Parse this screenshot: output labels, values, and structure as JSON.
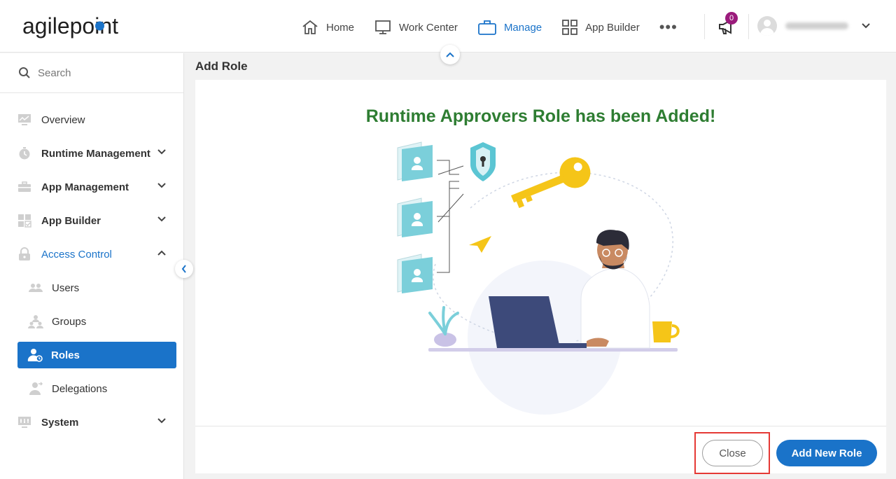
{
  "header": {
    "logo_text": "agilepoint",
    "nav": [
      {
        "label": "Home",
        "icon": "home-icon"
      },
      {
        "label": "Work Center",
        "icon": "monitor-icon"
      },
      {
        "label": "Manage",
        "icon": "briefcase-icon",
        "active": true
      },
      {
        "label": "App Builder",
        "icon": "grid-icon"
      }
    ],
    "more_label": "•••",
    "notification_count": "0"
  },
  "sidebar": {
    "search_placeholder": "Search",
    "items": [
      {
        "label": "Overview",
        "icon": "chart-icon"
      },
      {
        "label": "Runtime Management",
        "icon": "clock-icon"
      },
      {
        "label": "App Management",
        "icon": "toolbox-icon"
      },
      {
        "label": "App Builder",
        "icon": "grid-check-icon"
      },
      {
        "label": "Access Control",
        "icon": "lock-icon"
      },
      {
        "label": "Users",
        "icon": "users-icon"
      },
      {
        "label": "Groups",
        "icon": "groups-icon"
      },
      {
        "label": "Roles",
        "icon": "role-user-icon"
      },
      {
        "label": "Delegations",
        "icon": "delegation-icon"
      },
      {
        "label": "System",
        "icon": "system-icon"
      }
    ]
  },
  "main": {
    "page_title": "Add Role",
    "success_message": "Runtime Approvers Role has been Added!",
    "close_label": "Close",
    "add_new_label": "Add New Role"
  },
  "colors": {
    "accent": "#1a73c9",
    "success": "#2e7d32",
    "badge": "#9b1b7c",
    "highlight": "#e53935"
  }
}
